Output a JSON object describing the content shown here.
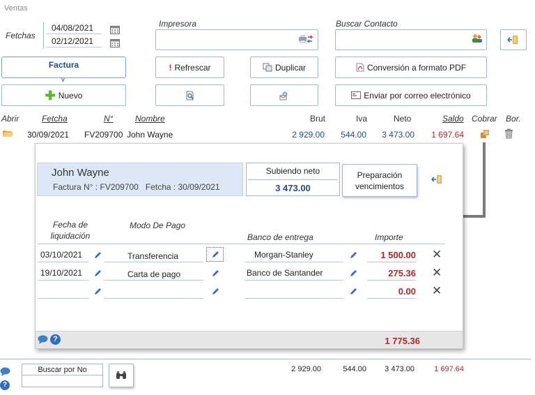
{
  "window": {
    "title": "Ventas"
  },
  "filters": {
    "dates_label": "Fetchas",
    "date_from": "04/08/2021",
    "date_to": "02/12/2021",
    "printer_label": "Impresora",
    "printer_value": "",
    "contact_label": "Buscar Contacto",
    "contact_value": ""
  },
  "toolbar": {
    "doc_type": "Factura",
    "doc_type_chevron": "v",
    "refresh": "Refrescar",
    "duplicate": "Duplicar",
    "pdf": "Conversión a formato PDF",
    "new": "Nuevo",
    "email": "Enviar por correo electrónico"
  },
  "table": {
    "columns": [
      "Abrir",
      "Fetcha",
      "N°",
      "Nombre",
      "Brut",
      "Iva",
      "Neto",
      "Saldo",
      "Cobrar",
      "Bor."
    ],
    "row": {
      "date": "30/09/2021",
      "number": "FV209700",
      "name": "John Wayne",
      "brut": "2 929.00",
      "iva": "544.00",
      "neto": "3 473.00",
      "saldo": "1 697.64"
    }
  },
  "panel": {
    "customer": "John Wayne",
    "invoice_line": "Factura N° : FV209700   Fetcha : 30/09/2021",
    "subtotal_label": "Subiendo neto",
    "subtotal_value": "3 473.00",
    "prep_button": "Preparación vencimientos",
    "col_date": "Fecha de liquidación",
    "col_mode": "Modo De Pago",
    "col_bank": "Banco de entrega",
    "col_amount": "Importe",
    "rows": [
      {
        "date": "03/10/2021",
        "mode": "Transferencia",
        "bank": "Morgan-Stanley",
        "amount": "1 500.00"
      },
      {
        "date": "19/10/2021",
        "mode": "Carta de pago",
        "bank": "Banco de Santander",
        "amount": "275.36"
      },
      {
        "date": "",
        "mode": "",
        "bank": "",
        "amount": "0.00"
      }
    ],
    "total": "1 775.36"
  },
  "footer": {
    "search_label": "Buscar por No",
    "search_value": "",
    "brut": "2 929.00",
    "iva": "544.00",
    "neto": "3 473.00",
    "saldo": "1 697.64"
  },
  "colors": {
    "accent": "#9fb7d3",
    "red": "#b3262b",
    "blue": "#1f4e8c",
    "panel_header": "#dce8f5"
  }
}
